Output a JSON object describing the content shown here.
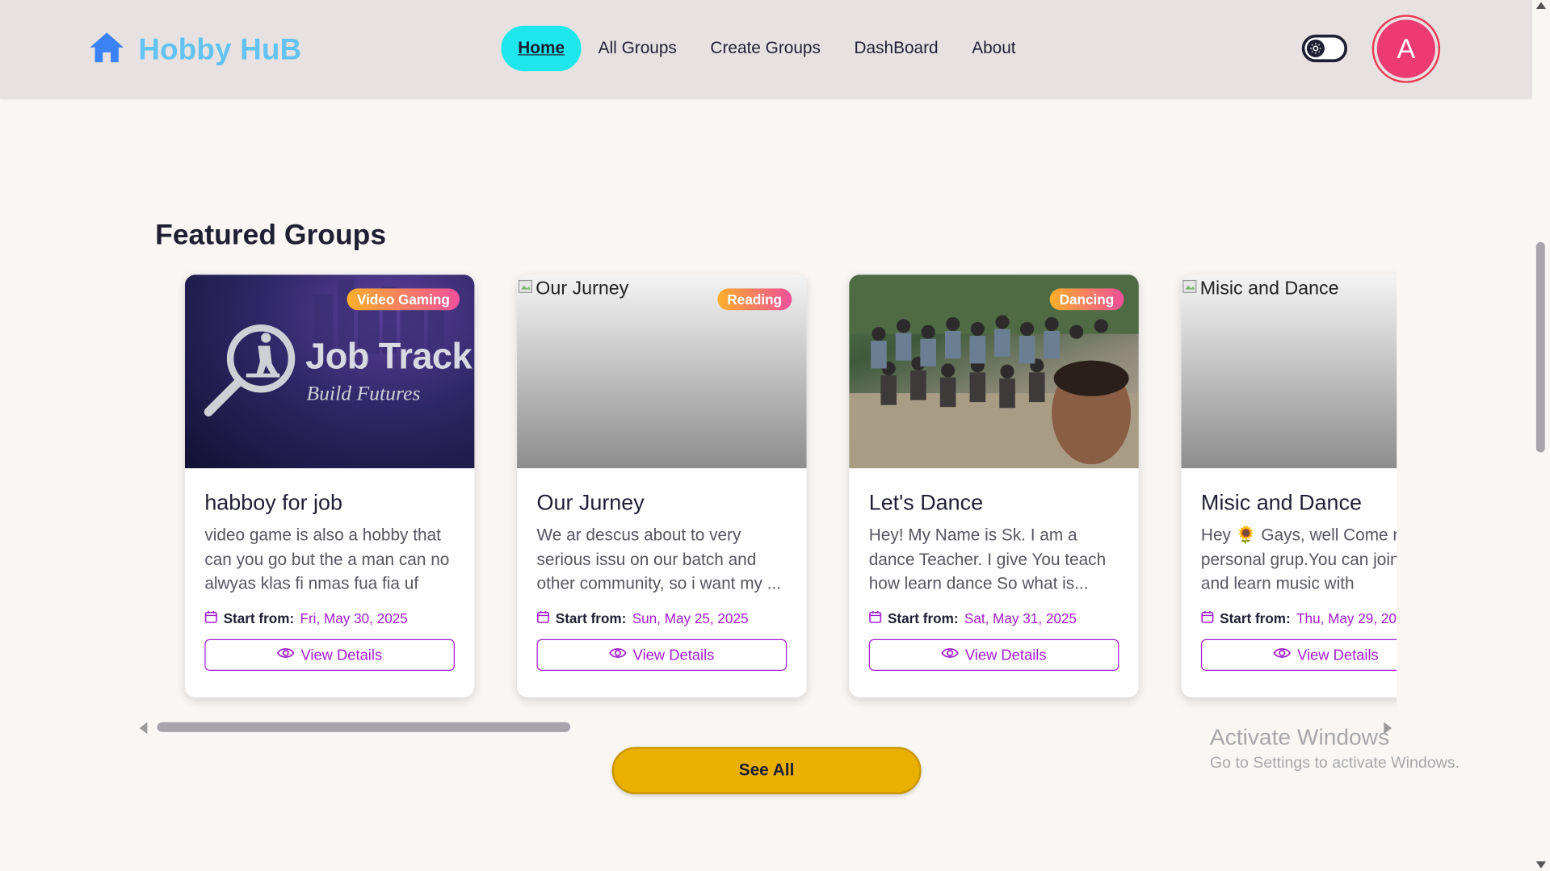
{
  "brand": {
    "name": "Hobby HuB",
    "icon": "home-icon",
    "color": "#62c3f2"
  },
  "nav": {
    "items": [
      {
        "label": "Home",
        "active": true
      },
      {
        "label": "All Groups",
        "active": false
      },
      {
        "label": "Create Groups",
        "active": false
      },
      {
        "label": "DashBoard",
        "active": false
      },
      {
        "label": "About",
        "active": false
      }
    ],
    "active_color": "#1de6ec"
  },
  "theme_toggle": {
    "icon": "sun-icon"
  },
  "user": {
    "avatar_initial": "A",
    "avatar_color": "#ee3a73"
  },
  "featured": {
    "title": "Featured Groups",
    "date_label": "Start from:",
    "view_button_label": "View Details",
    "cards": [
      {
        "title": "habboy for job",
        "category": "Video Gaming",
        "image_alt": "",
        "image_text": {
          "line1": "Job Track",
          "line2": "Build Futures"
        },
        "description": "video game is also a hobby that can you go but the a man can no alwyas klas fi nmas fua fia uf fja...",
        "date": "Fri, May 30, 2025"
      },
      {
        "title": "Our Jurney",
        "category": "Reading",
        "image_alt": "Our Jurney",
        "description": "We ar descus about to very serious issu on our batch and other community, so i want my ...",
        "date": "Sun, May 25, 2025"
      },
      {
        "title": "Let's Dance",
        "category": "Dancing",
        "image_alt": "",
        "description": "Hey! My Name is Sk. I am a dance Teacher. I give You teach how learn dance So what is...",
        "date": "Sat, May 31, 2025"
      },
      {
        "title": "Misic and Dance",
        "category": "",
        "image_alt": "Misic and Dance",
        "description": "Hey 🌻 Gays, well Come m personal grup.You can join grup and learn music with",
        "date": "Thu, May 29, 20"
      }
    ],
    "accent_color": "#a21cd0"
  },
  "see_all": {
    "label": "See All",
    "color": "#eab000"
  },
  "watermark": {
    "title": "Activate Windows",
    "subtitle": "Go to Settings to activate Windows."
  }
}
